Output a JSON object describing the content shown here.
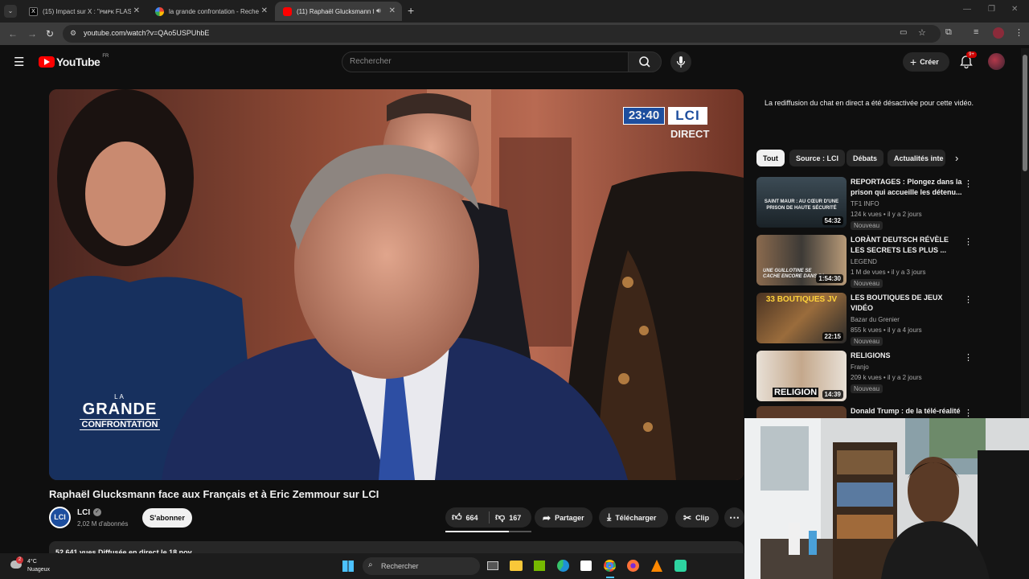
{
  "browser": {
    "tabs": [
      {
        "label": "(15) Impact sur X : \"ᴘᴍᴘᴋ FLASH",
        "active": false,
        "favicon_color": "#000000"
      },
      {
        "label": "la grande confrontation - Reche",
        "active": false,
        "favicon_color": "#4285f4"
      },
      {
        "label": "(11) Raphaël Glucksmann fa",
        "active": true,
        "favicon_color": "#ff0000"
      }
    ],
    "new_tab_glyph": "+",
    "url": "youtube.com/watch?v=QAo5USPUhbE"
  },
  "youtube": {
    "logo_text": "YouTube",
    "region": "FR",
    "search_placeholder": "Rechercher",
    "create_label": "Créer",
    "notification_count": "9+"
  },
  "video": {
    "overlay_time": "23:40",
    "overlay_channel": "LCI",
    "overlay_direct": "DIRECT",
    "show_logo_line1": "LA",
    "show_logo_line2": "GRANDE",
    "show_logo_line3": "CONFRONTATION",
    "title": "Raphaël Glucksmann face aux Français et à Eric Zemmour sur LCI",
    "channel_avatar": "LCI",
    "channel_name": "LCI",
    "subscribers": "2,02 M d'abonnés",
    "subscribe_label": "S'abonner",
    "likes": "664",
    "dislikes": "167",
    "share_label": "Partager",
    "download_label": "Télécharger",
    "clip_label": "Clip",
    "description_partial": "52 641 vues  Diffusée en direct le 18 nov."
  },
  "sidebar": {
    "chat_note": "La rediffusion du chat en direct a été désactivée pour cette vidéo.",
    "chips": [
      "Tout",
      "Source : LCI",
      "Débats",
      "Actualités inte"
    ],
    "recommendations": [
      {
        "title": "REPORTAGES : Plongez dans la prison qui accueille les détenu...",
        "channel": "TF1 INFO",
        "meta": "124 k vues • il y a 2 jours",
        "badge": "Nouveau",
        "duration": "54:32",
        "thumb_text": "SAINT MAUR : AU CŒUR D'UNE PRISON DE HAUTE SÉCURITÉ"
      },
      {
        "title": "LORÀNT DEUTSCH RÉVÈLE LES SECRETS LES PLUS ...",
        "channel": "LEGEND",
        "meta": "1 M de vues • il y a 3 jours",
        "badge": "Nouveau",
        "duration": "1:54:30",
        "thumb_text": "UNE GUILLOTINE SE CACHE ENCORE DANS PA"
      },
      {
        "title": "LES BOUTIQUES DE JEUX VIDÉO",
        "channel": "Bazar du Grenier",
        "meta": "855 k vues • il y a 4 jours",
        "badge": "Nouveau",
        "duration": "22:15",
        "thumb_text": "33 BOUTIQUES JV"
      },
      {
        "title": "RELIGIONS",
        "channel": "Franjo",
        "meta": "209 k vues • il y a 2 jours",
        "badge": "Nouveau",
        "duration": "14:39",
        "thumb_text": "RELIGION"
      },
      {
        "title": "Donald Trump : de la télé-réalité",
        "channel": "",
        "meta": "",
        "badge": "",
        "duration": "",
        "thumb_text": ""
      }
    ]
  },
  "taskbar": {
    "weather_temp": "4°C",
    "weather_desc": "Nuageux",
    "weather_badge": "2",
    "search_placeholder": "Rechercher"
  },
  "colors": {
    "background": "#0f0f0f",
    "youtube_red": "#ff0000",
    "lci_blue": "#1d4e9e"
  }
}
